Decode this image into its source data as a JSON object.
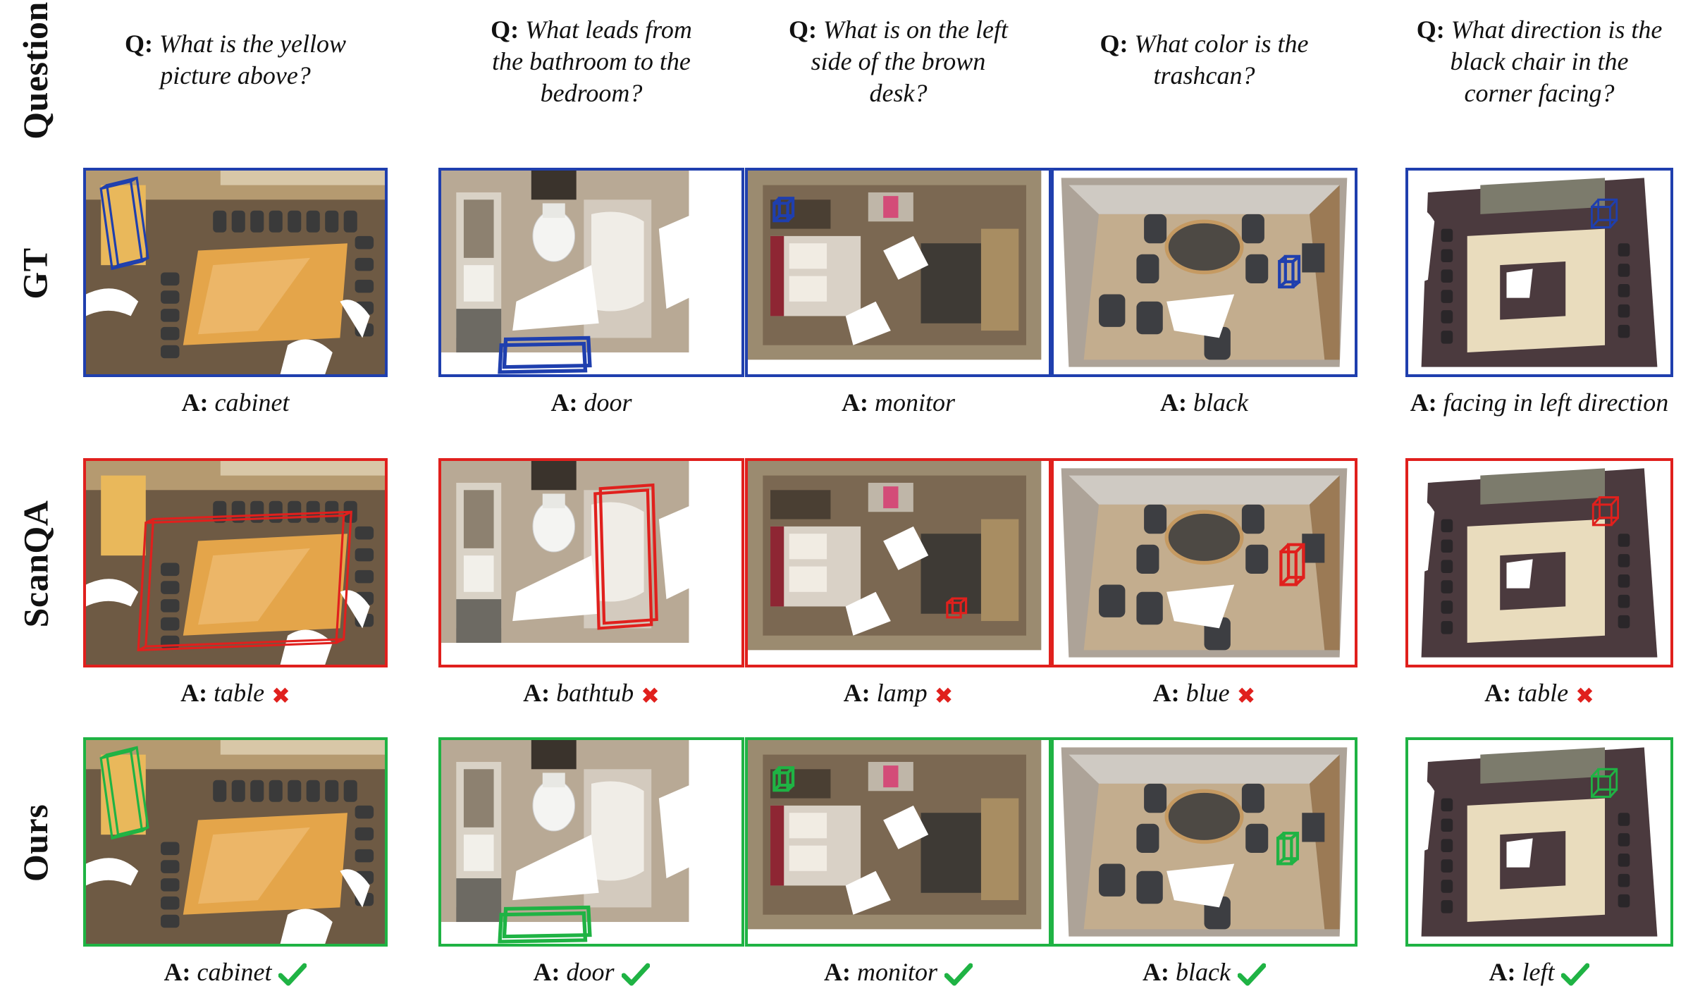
{
  "row_labels": {
    "question": "Question",
    "gt": "GT",
    "scanqa": "ScanQA",
    "ours": "Ours"
  },
  "q_prefix": "Q:",
  "a_prefix": "A:",
  "columns": [
    {
      "question_lines": [
        "What is the yellow",
        "picture above?"
      ],
      "gt_answer": "cabinet",
      "scanqa_answer": "table",
      "scanqa_correct": false,
      "ours_answer": "cabinet",
      "ours_correct": true,
      "scene": "conference room with large orange table"
    },
    {
      "question_lines": [
        "What leads from",
        "the bathroom to the",
        "bedroom?"
      ],
      "gt_answer": "door",
      "scanqa_answer": "bathtub",
      "scanqa_correct": false,
      "ours_answer": "door",
      "ours_correct": true,
      "scene": "bathroom with toilet, sink and bathtub"
    },
    {
      "question_lines": [
        "What is on the left",
        "side of the brown",
        "desk?"
      ],
      "gt_answer": "monitor",
      "scanqa_answer": "lamp",
      "scanqa_correct": false,
      "ours_answer": "monitor",
      "ours_correct": true,
      "scene": "bedroom with bed and desk"
    },
    {
      "question_lines": [
        "What color is the",
        "trashcan?"
      ],
      "gt_answer": "black",
      "scanqa_answer": "blue",
      "scanqa_correct": false,
      "ours_answer": "black",
      "ours_correct": true,
      "scene": "room with round table and black chairs"
    },
    {
      "question_lines": [
        "What direction is the",
        "black chair in the",
        "corner facing?"
      ],
      "gt_answer": "facing in left direction",
      "scanqa_answer": "table",
      "scanqa_correct": false,
      "ours_answer": "left",
      "ours_correct": true,
      "scene": "room with square table arrangement"
    }
  ],
  "colors": {
    "gt": "#1f3fae",
    "scanqa": "#e0201d",
    "ours": "#1fb344"
  }
}
